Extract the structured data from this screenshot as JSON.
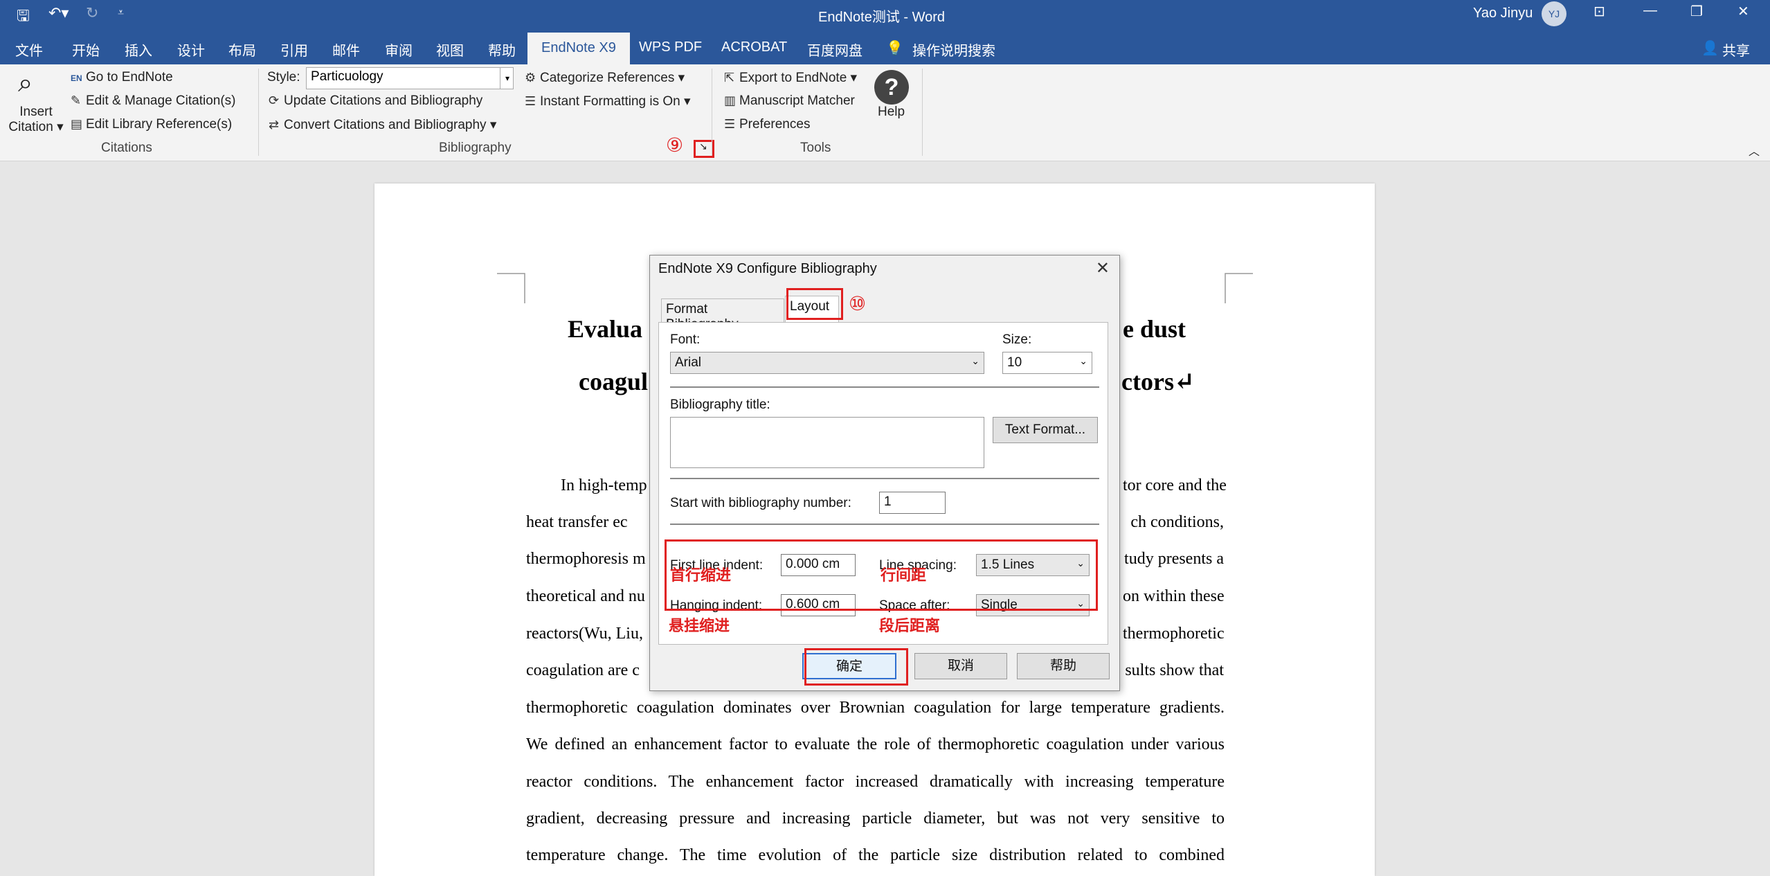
{
  "window": {
    "title": "EndNote测试  -  Word",
    "user": "Yao Jinyu",
    "initials": "YJ",
    "share": "共享"
  },
  "tabs": [
    "文件",
    "开始",
    "插入",
    "设计",
    "布局",
    "引用",
    "邮件",
    "审阅",
    "视图",
    "帮助",
    "EndNote X9",
    "WPS PDF",
    "ACROBAT",
    "百度网盘",
    "操作说明搜索"
  ],
  "ribbon": {
    "insert_citation": "Insert Citation",
    "go_to_endnote": "Go to EndNote",
    "edit_manage": "Edit & Manage Citation(s)",
    "edit_library": "Edit Library Reference(s)",
    "group_citations": "Citations",
    "style_label": "Style:",
    "style_value": "Particuology",
    "update_citations": "Update Citations and Bibliography",
    "convert_citations": "Convert Citations and Bibliography",
    "categorize": "Categorize References",
    "instant_formatting": "Instant Formatting is On",
    "group_bibliography": "Bibliography",
    "export_endnote": "Export to EndNote",
    "manuscript_matcher": "Manuscript Matcher",
    "preferences": "Preferences",
    "help": "Help",
    "group_tools": "Tools"
  },
  "annotations": {
    "num9": "⑨",
    "num10": "⑩",
    "first_indent_zh": "首行缩进",
    "line_spacing_zh": "行间距",
    "hanging_indent_zh": "悬挂缩进",
    "space_after_zh": "段后距离"
  },
  "document": {
    "title_line1_left": "Evalua",
    "title_line1_right": "e dust",
    "title_line2_left": "coagul",
    "title_line2_right": "ctors↵",
    "lines": [
      {
        "left": "In high-temp",
        "right": "tor core and the"
      },
      {
        "left": "heat transfer ec",
        "right": "ch  conditions,"
      },
      {
        "left": "thermophoresis m",
        "right": "tudy presents a"
      },
      {
        "left": "theoretical and nu",
        "right": "on within these"
      },
      {
        "left": "reactors(Wu, Liu,",
        "right": "thermophoretic"
      },
      {
        "left": "coagulation are c",
        "right": "sults show that"
      }
    ],
    "full_lines": [
      "thermophoretic coagulation dominates over Brownian coagulation for large temperature gradients.",
      "We defined an enhancement factor to evaluate the role of thermophoretic coagulation under various",
      "reactor conditions. The enhancement factor increased dramatically with increasing temperature",
      "gradient, decreasing pressure and increasing particle diameter, but was not very sensitive to",
      "temperature change. The time evolution of the particle size distribution related to combined"
    ]
  },
  "dialog": {
    "title": "EndNote X9 Configure Bibliography",
    "tab_format": "Format Bibliography",
    "tab_layout": "Layout",
    "font_label": "Font:",
    "font_value": "Arial",
    "size_label": "Size:",
    "size_value": "10",
    "bib_title_label": "Bibliography title:",
    "text_format_btn": "Text Format...",
    "start_number_label": "Start with bibliography number:",
    "start_number_value": "1",
    "first_indent_label": "First line indent:",
    "first_indent_value": "0.000 cm",
    "hanging_indent_label": "Hanging indent:",
    "hanging_indent_value": "0.600 cm",
    "line_spacing_label": "Line spacing:",
    "line_spacing_value": "1.5 Lines",
    "space_after_label": "Space after:",
    "space_after_value": "Single",
    "ok": "确定",
    "cancel": "取消",
    "help": "帮助"
  }
}
